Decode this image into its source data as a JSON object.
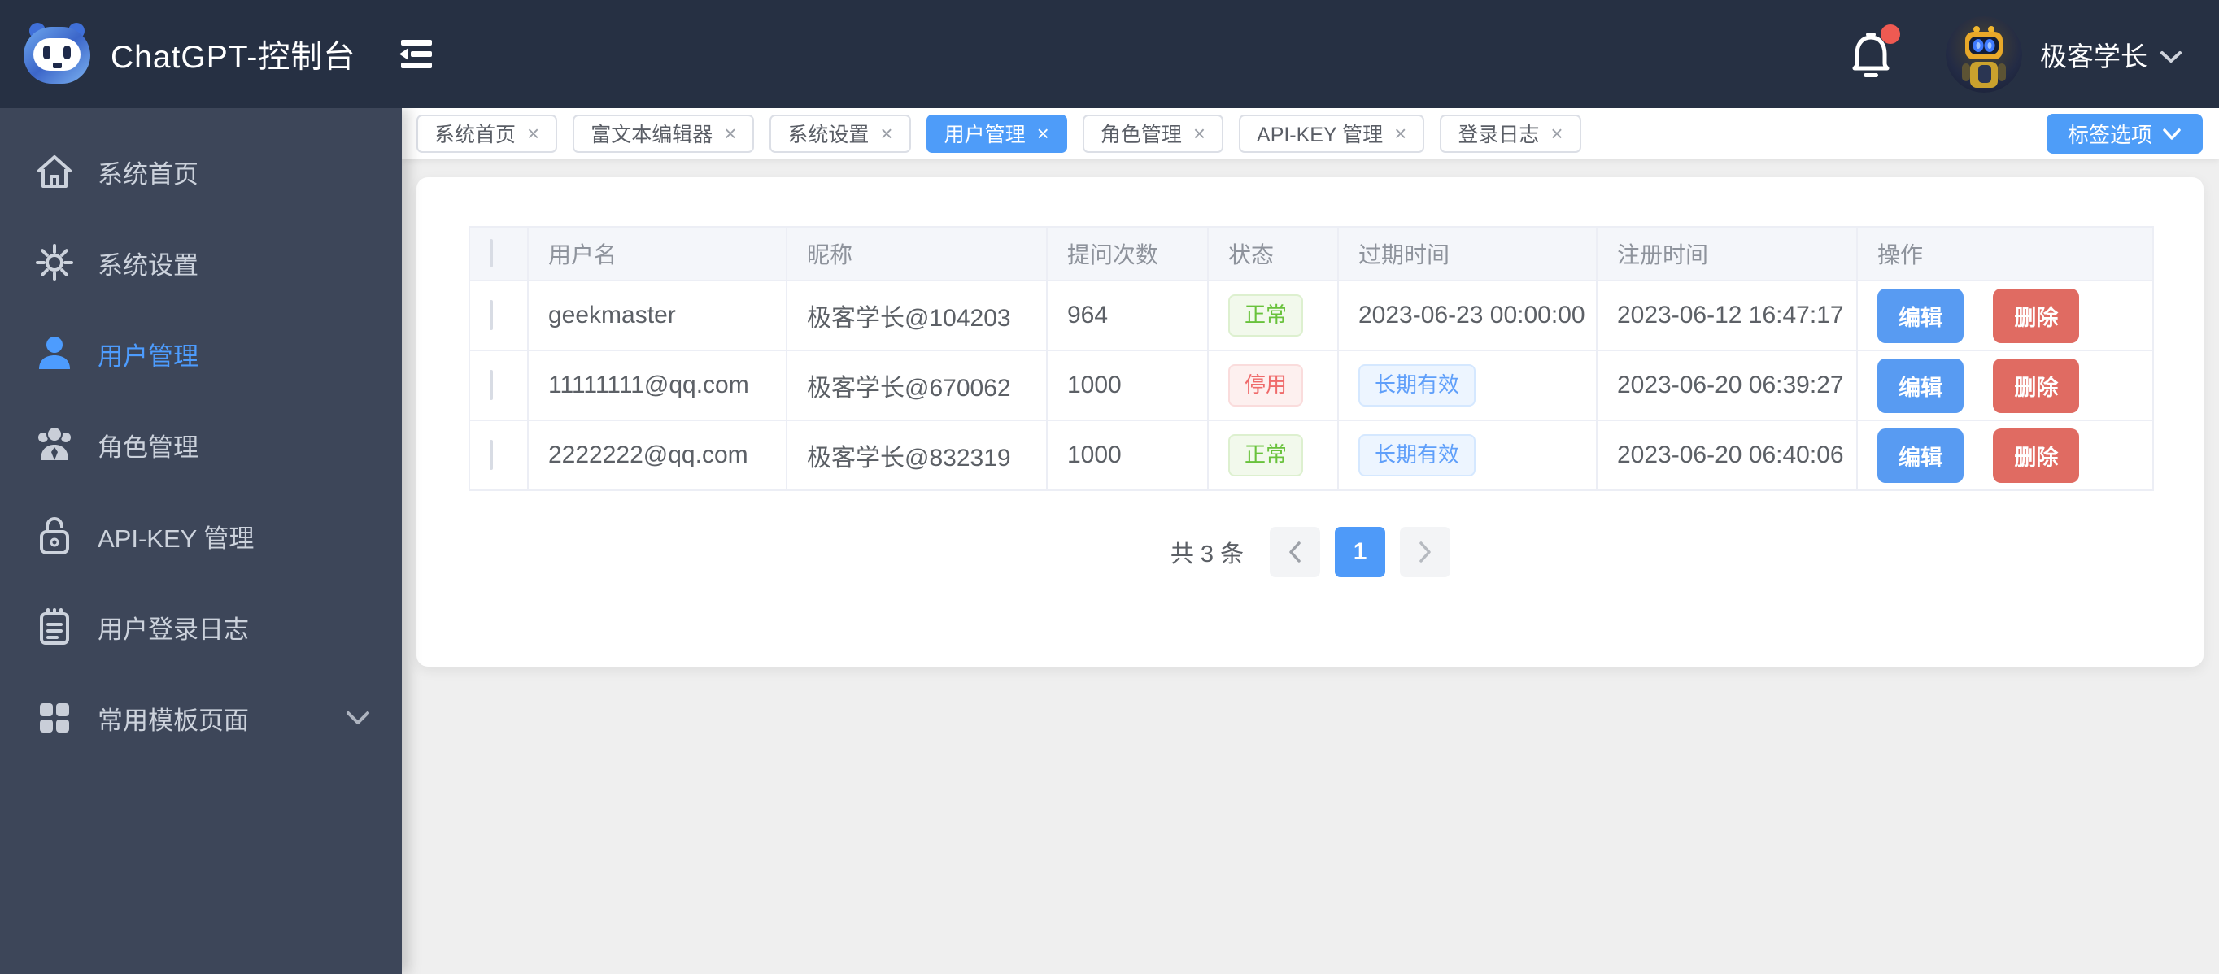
{
  "app": {
    "title": "ChatGPT-控制台"
  },
  "header": {
    "logo_icon": "robot-logo-icon",
    "fold_icon": "menu-fold-icon",
    "bell_icon": "bell-icon",
    "notification_dot": true,
    "user_name": "极客学长",
    "user_caret_icon": "chevron-down-icon"
  },
  "sidebar": {
    "items": [
      {
        "label": "系统首页",
        "icon": "home-icon",
        "active": false
      },
      {
        "label": "系统设置",
        "icon": "gear-icon",
        "active": false
      },
      {
        "label": "用户管理",
        "icon": "user-icon",
        "active": true
      },
      {
        "label": "角色管理",
        "icon": "roles-icon",
        "active": false
      },
      {
        "label": "API-KEY 管理",
        "icon": "lock-icon",
        "active": false
      },
      {
        "label": "用户登录日志",
        "icon": "log-icon",
        "active": false
      },
      {
        "label": "常用模板页面",
        "icon": "grid-icon",
        "active": false,
        "trailing_icon": "chevron-down-icon"
      }
    ]
  },
  "tabs": {
    "items": [
      {
        "label": "系统首页",
        "active": false
      },
      {
        "label": "富文本编辑器",
        "active": false
      },
      {
        "label": "系统设置",
        "active": false
      },
      {
        "label": "用户管理",
        "active": true
      },
      {
        "label": "角色管理",
        "active": false
      },
      {
        "label": "API-KEY 管理",
        "active": false
      },
      {
        "label": "登录日志",
        "active": false
      }
    ],
    "close_glyph": "×",
    "options_button": "标签选项"
  },
  "table": {
    "columns": [
      "用户名",
      "昵称",
      "提问次数",
      "状态",
      "过期时间",
      "注册时间",
      "操作"
    ],
    "rows": [
      {
        "username": "geekmaster",
        "nickname": "极客学长@104203",
        "count": "964",
        "status": {
          "label": "正常",
          "type": "success"
        },
        "expire": {
          "label": "2023-06-23 00:00:00",
          "type": "text"
        },
        "registered": "2023-06-12 16:47:17",
        "actions": {
          "edit": "编辑",
          "delete": "删除"
        }
      },
      {
        "username": "11111111@qq.com",
        "nickname": "极客学长@670062",
        "count": "1000",
        "status": {
          "label": "停用",
          "type": "danger"
        },
        "expire": {
          "label": "长期有效",
          "type": "tag"
        },
        "registered": "2023-06-20 06:39:27",
        "actions": {
          "edit": "编辑",
          "delete": "删除"
        }
      },
      {
        "username": "2222222@qq.com",
        "nickname": "极客学长@832319",
        "count": "1000",
        "status": {
          "label": "正常",
          "type": "success"
        },
        "expire": {
          "label": "长期有效",
          "type": "tag"
        },
        "registered": "2023-06-20 06:40:06",
        "actions": {
          "edit": "编辑",
          "delete": "删除"
        }
      }
    ]
  },
  "pagination": {
    "total_label": "共 3 条",
    "current_page": "1",
    "prev_icon": "chevron-left-icon",
    "next_icon": "chevron-right-icon"
  },
  "colors": {
    "header_bg": "#263043",
    "sidebar_bg": "#3d4659",
    "primary_blue": "#4e9cf9",
    "edit_button": "#589bf2",
    "delete_button": "#e06b62",
    "success_text": "#69c23c",
    "danger_text": "#ef6a6a",
    "tag_blue_text": "#5f9ffa",
    "content_bg": "#efefef",
    "notification_dot": "#ef5a52"
  }
}
